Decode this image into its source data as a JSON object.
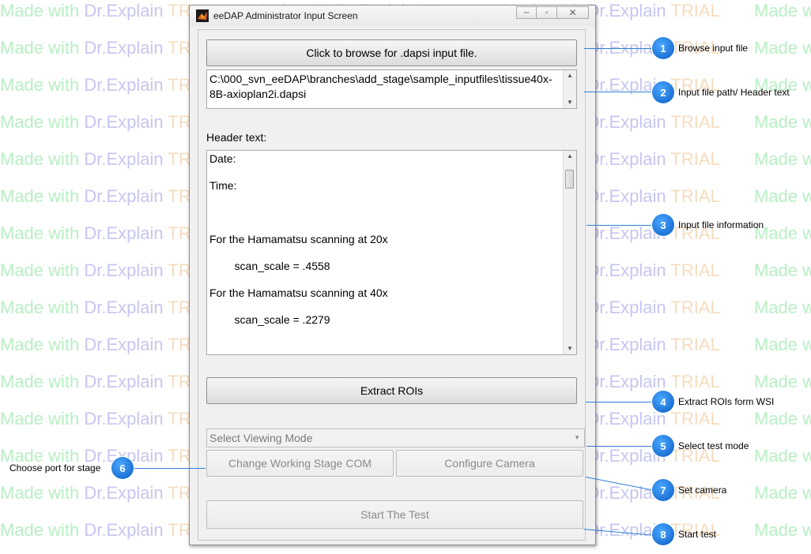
{
  "watermark": {
    "part1": "Made with ",
    "part2": "Dr.Explain ",
    "part3": "TRIAL"
  },
  "window": {
    "title": "eeDAP Administrator Input Screen",
    "controls": {
      "minimize": "─",
      "maximize": "▫",
      "close": "✕"
    }
  },
  "browse_button": {
    "label": "Click to browse for .dapsi input file."
  },
  "file_path": {
    "line1": "C:\\000_svn_eeDAP\\branches\\add_stage\\sample_inputfiles\\tissue40x-",
    "line2": "8B-axioplan2i.dapsi"
  },
  "header_label": "Header text:",
  "header_text": {
    "lines": [
      "Date:",
      "Time:",
      "",
      "For the Hamamatsu scanning at 20x",
      "    scan_scale = .4558",
      "For the Hamamatsu scanning at 40x",
      "    scan_scale = .2279"
    ]
  },
  "extract_button": {
    "label": "Extract ROIs"
  },
  "viewing_mode": {
    "selected": "Select Viewing Mode"
  },
  "stage_com_button": {
    "label": "Change Working Stage COM"
  },
  "camera_button": {
    "label": "Configure Camera"
  },
  "start_button": {
    "label": "Start The Test"
  },
  "callouts": [
    {
      "number": "1",
      "text": "Browse input file"
    },
    {
      "number": "2",
      "text": "Input file path/ Header text"
    },
    {
      "number": "3",
      "text": "Input file information"
    },
    {
      "number": "4",
      "text": "Extract ROIs form WSI"
    },
    {
      "number": "5",
      "text": "Select test mode"
    },
    {
      "number": "6",
      "text": "Choose port for stage"
    },
    {
      "number": "7",
      "text": "Set camera"
    },
    {
      "number": "8",
      "text": "Start test"
    }
  ],
  "colors": {
    "callout_blue": "#1d72d6",
    "wm_green": "#b8efc4",
    "wm_purple": "#c6c6f1",
    "wm_orange": "#f6dcbe"
  }
}
